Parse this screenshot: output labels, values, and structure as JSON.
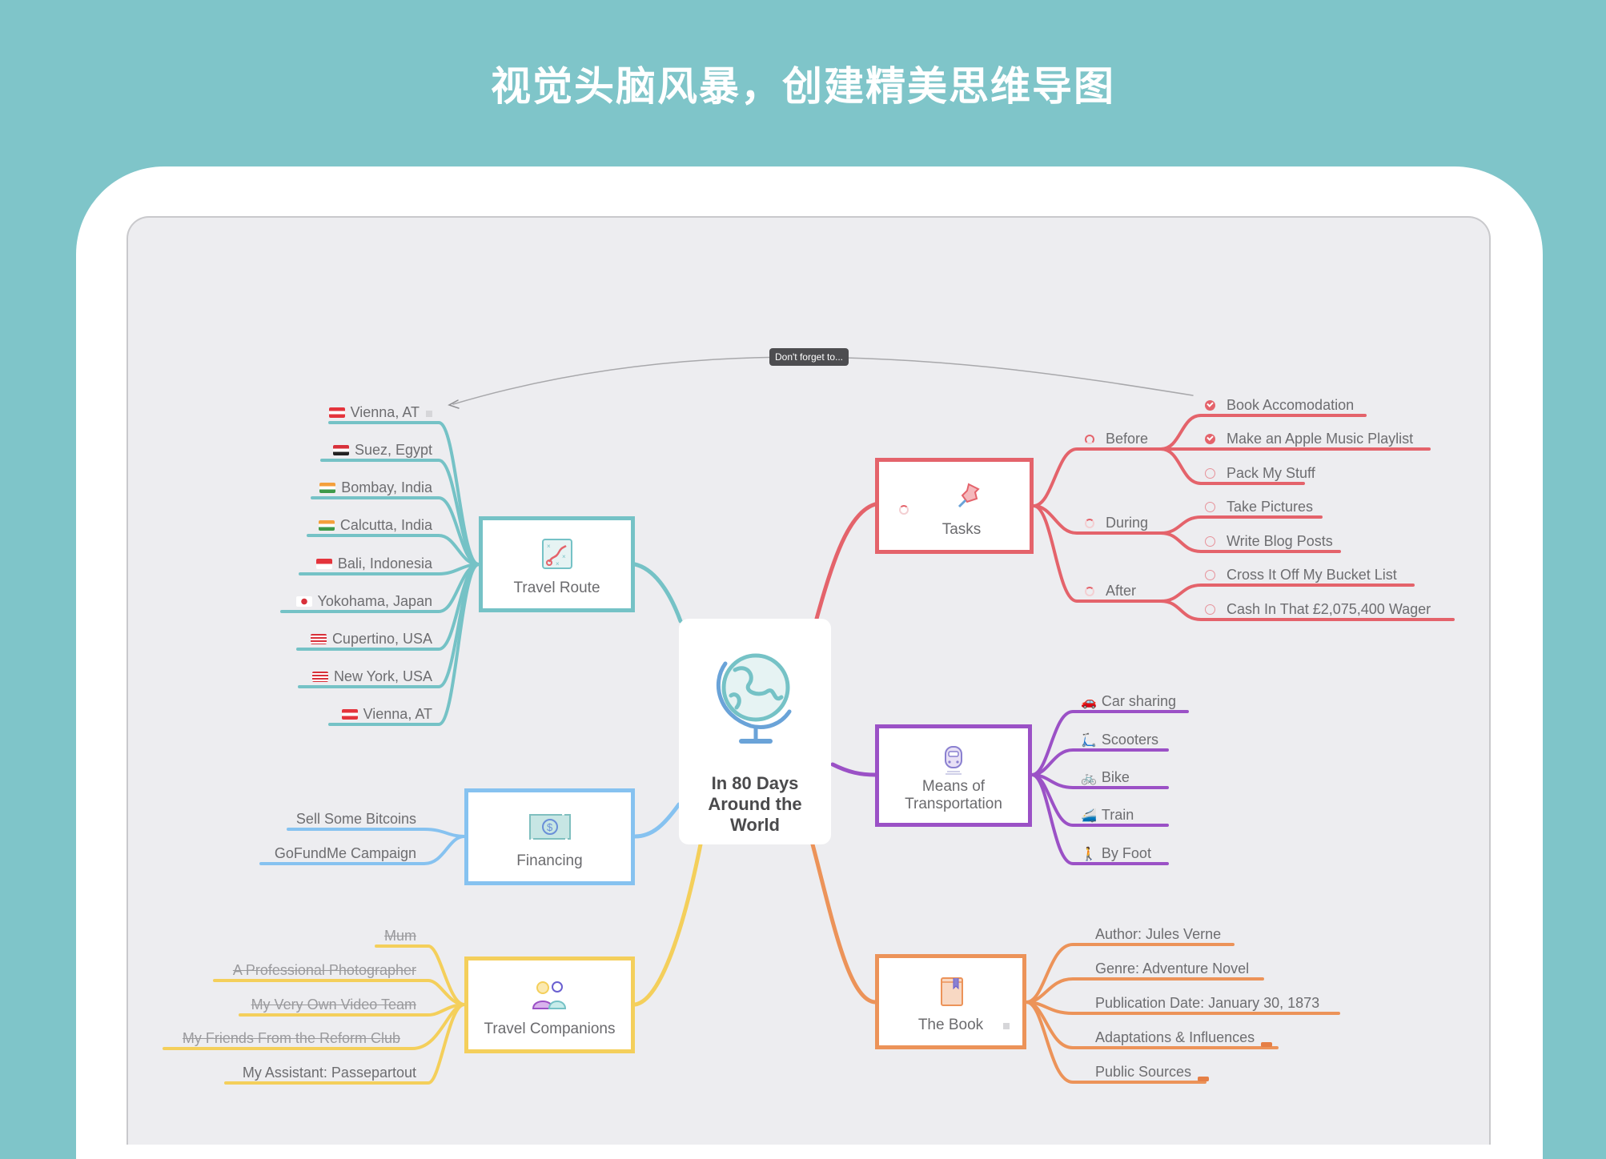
{
  "headline": "视觉头脑风暴，创建精美思维导图",
  "colors": {
    "background": "#7fc5c9",
    "canvas": "#ededf0",
    "travel_route": "#75c2c6",
    "tasks": "#e4636b",
    "transport": "#9b51c6",
    "financing": "#86c2f0",
    "companions": "#f4cf5b",
    "book": "#ec9359"
  },
  "callout": {
    "label": "Don't forget to..."
  },
  "central": {
    "title": "In 80 Days Around the World",
    "icon": "globe-icon"
  },
  "topics": {
    "travel_route": {
      "label": "Travel Route",
      "icon": "map-route-icon",
      "items": [
        {
          "flag": "AT",
          "label": "Vienna, AT",
          "note": true
        },
        {
          "flag": "EG",
          "label": "Suez, Egypt"
        },
        {
          "flag": "IN",
          "label": "Bombay, India"
        },
        {
          "flag": "IN",
          "label": "Calcutta, India"
        },
        {
          "flag": "ID",
          "label": "Bali, Indonesia"
        },
        {
          "flag": "JP",
          "label": "Yokohama, Japan"
        },
        {
          "flag": "US",
          "label": "Cupertino, USA"
        },
        {
          "flag": "US",
          "label": "New York, USA"
        },
        {
          "flag": "AT",
          "label": "Vienna, AT"
        }
      ]
    },
    "financing": {
      "label": "Financing",
      "icon": "money-bill-icon",
      "items": [
        {
          "label": "Sell Some Bitcoins"
        },
        {
          "label": "GoFundMe Campaign"
        }
      ]
    },
    "companions": {
      "label": "Travel Companions",
      "icon": "people-icon",
      "items": [
        {
          "label": "Mum",
          "done": true
        },
        {
          "label": "A Professional Photographer",
          "done": true
        },
        {
          "label": "My Very Own Video Team",
          "done": true
        },
        {
          "label": "My Friends From the Reform Club",
          "done": true
        },
        {
          "label": "My Assistant: Passepartout",
          "done": false
        }
      ]
    },
    "tasks": {
      "label": "Tasks",
      "icon": "pushpin-icon",
      "groups": [
        {
          "label": "Before",
          "items": [
            {
              "label": "Book Accomodation",
              "done": true
            },
            {
              "label": "Make an Apple Music Playlist",
              "done": true
            },
            {
              "label": "Pack My Stuff",
              "done": false
            }
          ]
        },
        {
          "label": "During",
          "items": [
            {
              "label": "Take Pictures",
              "done": false
            },
            {
              "label": "Write Blog Posts",
              "done": false
            }
          ]
        },
        {
          "label": "After",
          "items": [
            {
              "label": "Cross It Off My Bucket List",
              "done": false
            },
            {
              "label": "Cash In That £2,075,400 Wager",
              "done": false
            }
          ]
        }
      ]
    },
    "transport": {
      "label": "Means of Transportation",
      "label_lines": [
        "Means of",
        "Transportation"
      ],
      "icon": "train-icon",
      "items": [
        {
          "emoji": "🚗",
          "label": "Car sharing"
        },
        {
          "emoji": "🛴",
          "label": "Scooters"
        },
        {
          "emoji": "🚲",
          "label": "Bike"
        },
        {
          "emoji": "🚄",
          "label": "Train"
        },
        {
          "emoji": "🚶",
          "label": "By Foot"
        }
      ]
    },
    "book": {
      "label": "The Book",
      "icon": "book-icon",
      "items": [
        {
          "label": "Author: Jules Verne"
        },
        {
          "label": "Genre: Adventure Novel"
        },
        {
          "label": "Publication Date: January 30, 1873"
        },
        {
          "label": "Adaptations & Influences",
          "more": true
        },
        {
          "label": "Public Sources",
          "more": true
        }
      ]
    }
  }
}
